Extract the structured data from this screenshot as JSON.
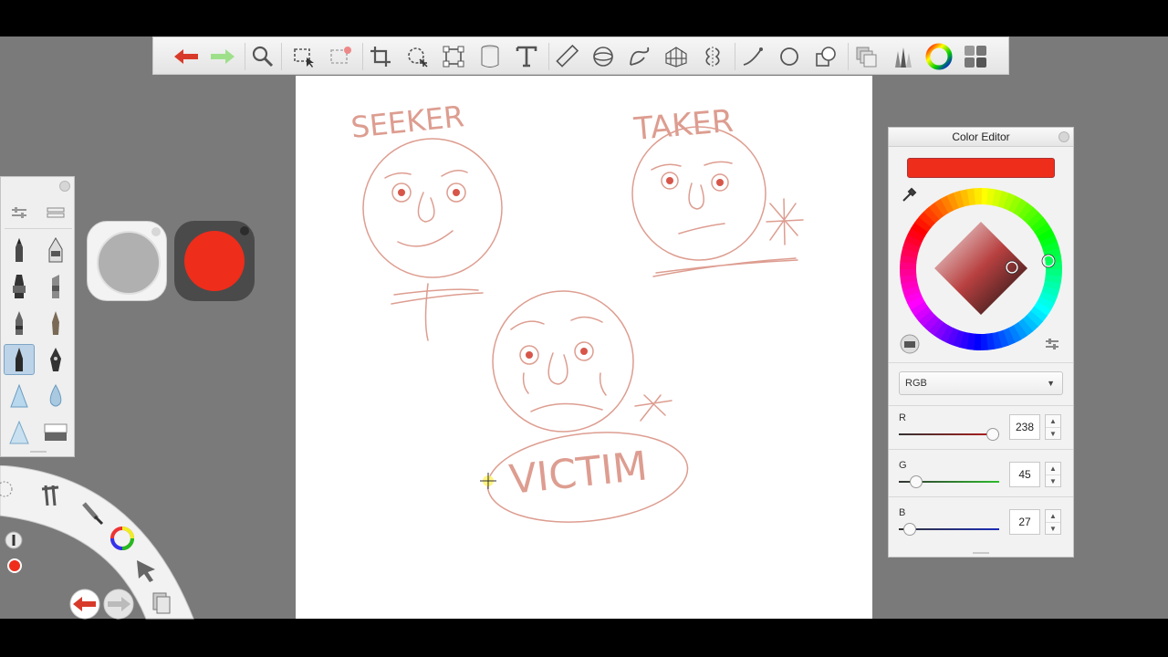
{
  "toolbar": {
    "tools": [
      "undo-icon",
      "redo-icon",
      "zoom-icon",
      "select-icon",
      "select-clear-icon",
      "crop-icon",
      "lasso-icon",
      "transform-icon",
      "fill-icon",
      "text-icon",
      "ruler-icon",
      "ellipse-guide-icon",
      "french-curve-icon",
      "perspective-icon",
      "symmetry-icon",
      "stroke-icon",
      "shape-icon",
      "shapes-icon",
      "layers-icon",
      "brushes-icon",
      "color-wheel-icon",
      "grid-icon"
    ]
  },
  "sketch": {
    "label_seeker": "SEEKER",
    "label_taker": "TAKER",
    "label_victim": "VICTIM",
    "stroke_color": "#e0a59a"
  },
  "current_color": "#ee2d1b",
  "color_editor": {
    "title": "Color Editor",
    "mode": "RGB",
    "channels": [
      {
        "label": "R",
        "value": 238,
        "max": 255,
        "track_color": "#b81b1b"
      },
      {
        "label": "G",
        "value": 45,
        "max": 255,
        "track_color": "#2dbb2d"
      },
      {
        "label": "B",
        "value": 27,
        "max": 255,
        "track_color": "#1b2cb8"
      }
    ]
  },
  "brush_panel": {
    "brushes": [
      "pencil-icon",
      "ink-pen-icon",
      "marker-icon",
      "chisel-marker-icon",
      "ballpoint-icon",
      "fine-pen-icon",
      "brush-pen-icon",
      "fountain-pen-icon",
      "airbrush-icon",
      "water-drop-icon",
      "soft-triangle-icon",
      "eraser-icon"
    ]
  }
}
